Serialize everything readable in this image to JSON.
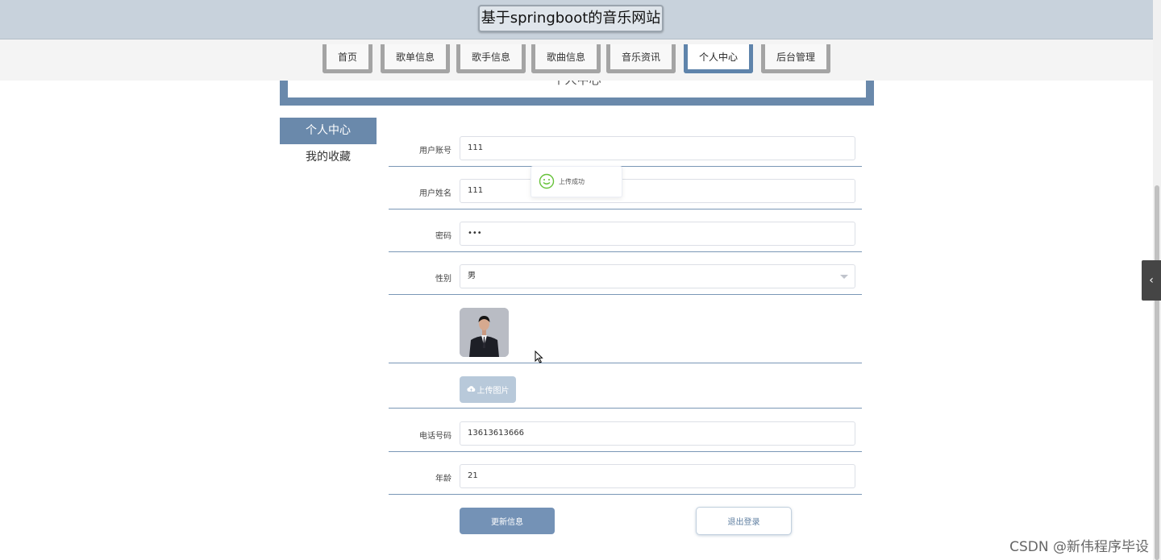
{
  "header": {
    "title": "基于springboot的音乐网站"
  },
  "nav": {
    "items": [
      {
        "label": "首页"
      },
      {
        "label": "歌单信息"
      },
      {
        "label": "歌手信息"
      },
      {
        "label": "歌曲信息"
      },
      {
        "label": "音乐资讯"
      },
      {
        "label": "个人中心",
        "active": true
      },
      {
        "label": "后台管理"
      }
    ]
  },
  "banner": {
    "title": "个人中心"
  },
  "side_menu": {
    "items": [
      {
        "label": "个人中心",
        "active": true
      },
      {
        "label": "我的收藏"
      }
    ]
  },
  "form": {
    "account": {
      "label": "用户账号",
      "value": "111"
    },
    "name": {
      "label": "用户姓名",
      "value": "111"
    },
    "password": {
      "label": "密码",
      "value": "•••"
    },
    "gender": {
      "label": "性别",
      "value": "男"
    },
    "upload_label": "上传图片",
    "phone": {
      "label": "电话号码",
      "value": "13613613666"
    },
    "age": {
      "label": "年龄",
      "value": "21"
    },
    "update_label": "更新信息",
    "logout_label": "退出登录"
  },
  "toast": {
    "message": "上传成功"
  },
  "watermark": "CSDN @新伟程序毕设",
  "colors": {
    "accent": "#6a89ab",
    "header": "#c8d2dc",
    "button": "#7492b6"
  },
  "icons": {
    "toast": "smile-icon",
    "upload": "cloud-upload-icon",
    "toggle": "chevron-left-icon"
  }
}
